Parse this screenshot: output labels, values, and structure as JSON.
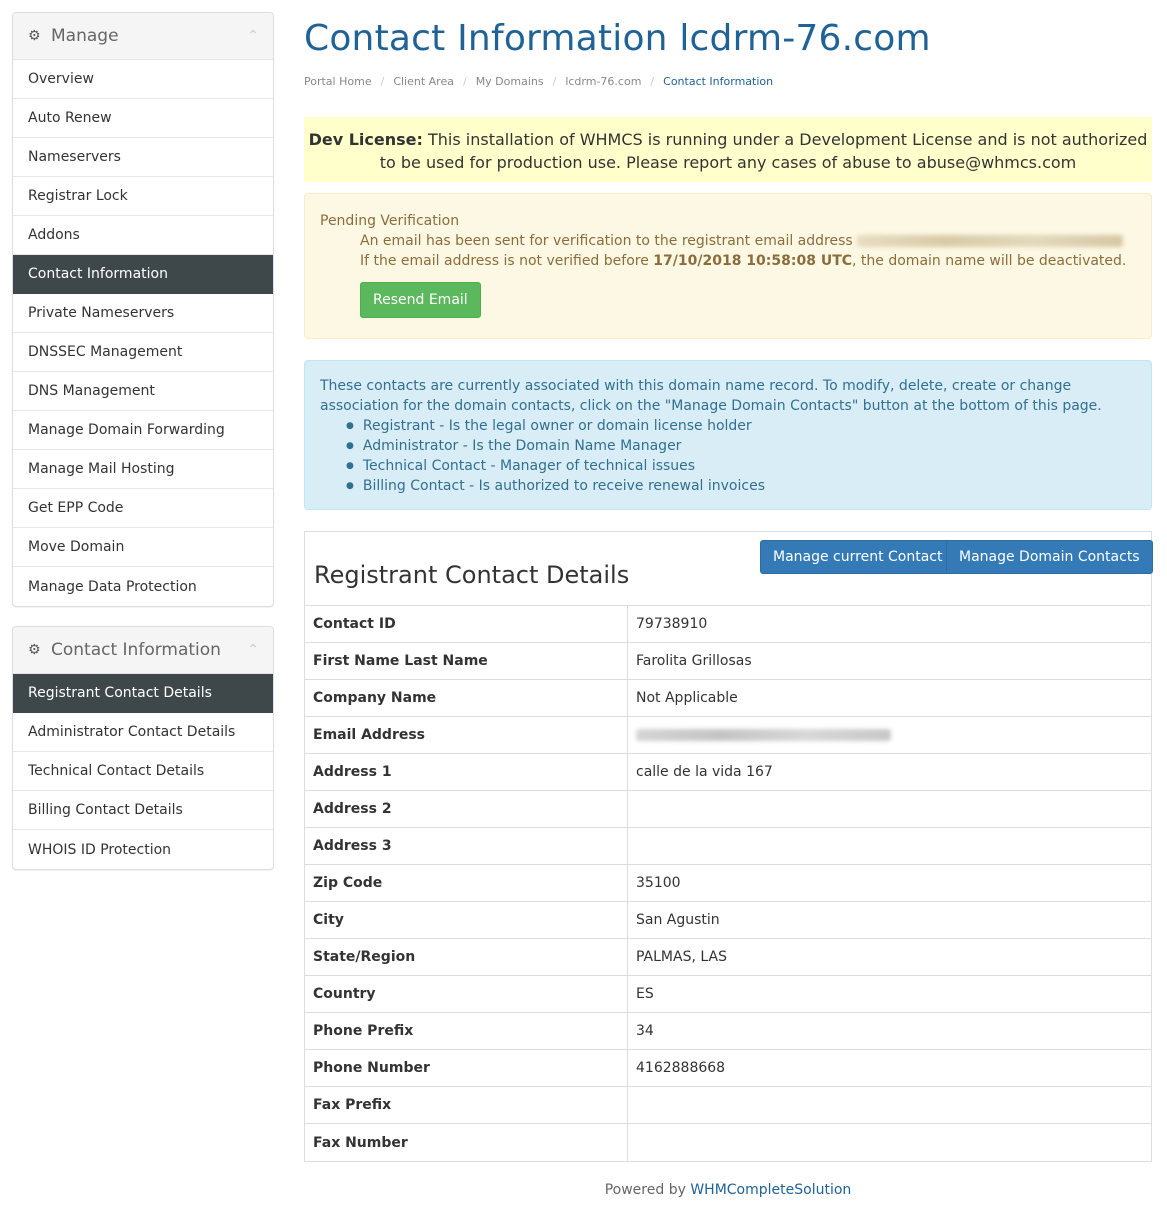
{
  "sidebar": {
    "manage": {
      "title": "Manage",
      "items": [
        {
          "label": "Overview"
        },
        {
          "label": "Auto Renew"
        },
        {
          "label": "Nameservers"
        },
        {
          "label": "Registrar Lock"
        },
        {
          "label": "Addons"
        },
        {
          "label": "Contact Information",
          "active": true
        },
        {
          "label": "Private Nameservers"
        },
        {
          "label": "DNSSEC Management"
        },
        {
          "label": "DNS Management"
        },
        {
          "label": "Manage Domain Forwarding"
        },
        {
          "label": "Manage Mail Hosting"
        },
        {
          "label": "Get EPP Code"
        },
        {
          "label": "Move Domain"
        },
        {
          "label": "Manage Data Protection"
        }
      ]
    },
    "contact": {
      "title": "Contact Information",
      "items": [
        {
          "label": "Registrant Contact Details",
          "active": true
        },
        {
          "label": "Administrator Contact Details"
        },
        {
          "label": "Technical Contact Details"
        },
        {
          "label": "Billing Contact Details"
        },
        {
          "label": "WHOIS ID Protection"
        }
      ]
    }
  },
  "header": {
    "title": "Contact Information lcdrm-76.com",
    "breadcrumb": [
      "Portal Home",
      "Client Area",
      "My Domains",
      "lcdrm-76.com",
      "Contact Information"
    ]
  },
  "dev_license": {
    "label": "Dev License:",
    "text": "This installation of WHMCS is running under a Development License and is not authorized to be used for production use. Please report any cases of abuse to abuse@whmcs.com"
  },
  "pending": {
    "title": "Pending Verification",
    "text_before": "An email has been sent for verification to the registrant email address",
    "text_after": "If the email address is not verified before",
    "deadline": "17/10/2018 10:58:08 UTC",
    "text_end": ", the domain name will be deactivated.",
    "resend_label": "Resend Email"
  },
  "info": {
    "text": "These contacts are currently associated with this domain name record. To modify, delete, create or change association for the domain contacts, click on the \"Manage Domain Contacts\" button at the bottom of this page.",
    "items": [
      "Registrant - Is the legal owner or domain license holder",
      "Administrator - Is the Domain Name Manager",
      "Technical Contact - Manager of technical issues",
      "Billing Contact - Is authorized to receive renewal invoices"
    ]
  },
  "details": {
    "title": "Registrant Contact Details",
    "manage_current_label": "Manage current Contact",
    "manage_domain_label": "Manage Domain Contacts",
    "rows": [
      {
        "key": "Contact ID",
        "value": "79738910"
      },
      {
        "key": "First Name Last Name",
        "value": "Farolita Grillosas"
      },
      {
        "key": "Company Name",
        "value": "Not Applicable"
      },
      {
        "key": "Email Address",
        "value": "",
        "blurred": true
      },
      {
        "key": "Address 1",
        "value": "calle de la vida 167"
      },
      {
        "key": "Address 2",
        "value": ""
      },
      {
        "key": "Address 3",
        "value": ""
      },
      {
        "key": "Zip Code",
        "value": "35100"
      },
      {
        "key": "City",
        "value": "San Agustin"
      },
      {
        "key": "State/Region",
        "value": "PALMAS, LAS"
      },
      {
        "key": "Country",
        "value": "ES"
      },
      {
        "key": "Phone Prefix",
        "value": "34"
      },
      {
        "key": "Phone Number",
        "value": "4162888668"
      },
      {
        "key": "Fax Prefix",
        "value": ""
      },
      {
        "key": "Fax Number",
        "value": ""
      }
    ]
  },
  "footer": {
    "prefix": "Powered by",
    "link": "WHMCompleteSolution"
  }
}
